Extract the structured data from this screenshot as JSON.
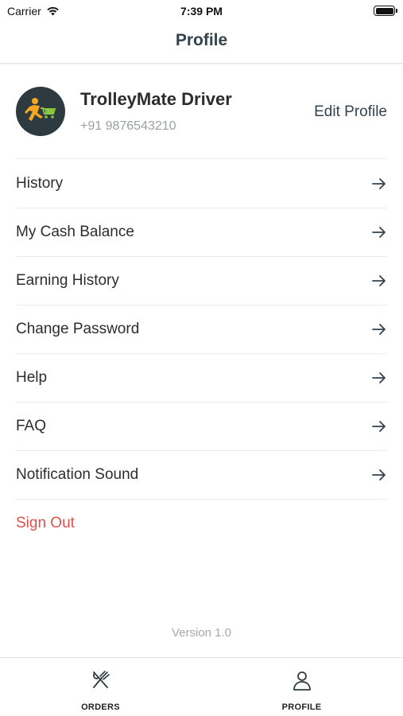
{
  "status_bar": {
    "carrier": "Carrier",
    "time": "7:39 PM",
    "wifi_icon": "wifi-icon",
    "battery_icon": "battery-icon"
  },
  "nav": {
    "title": "Profile"
  },
  "profile": {
    "avatar_icon": "trolleymate-logo",
    "name": "TrolleyMate Driver",
    "phone": "+91 9876543210",
    "edit_label": "Edit Profile"
  },
  "menu": {
    "items": [
      {
        "label": "History"
      },
      {
        "label": "My Cash Balance"
      },
      {
        "label": "Earning History"
      },
      {
        "label": "Change Password"
      },
      {
        "label": "Help"
      },
      {
        "label": "FAQ"
      },
      {
        "label": "Notification Sound"
      }
    ],
    "sign_out": "Sign Out",
    "arrow_icon": "arrow-right-icon"
  },
  "footer": {
    "version": "Version 1.0"
  },
  "tab_bar": {
    "tabs": [
      {
        "label": "ORDERS",
        "icon": "fork-knife-icon"
      },
      {
        "label": "PROFILE",
        "icon": "person-icon"
      }
    ]
  },
  "colors": {
    "accent": "#34434b",
    "danger": "#e0504f",
    "muted": "#9aa0a3",
    "logo_orange": "#f5a623",
    "logo_green": "#8cc63f"
  }
}
